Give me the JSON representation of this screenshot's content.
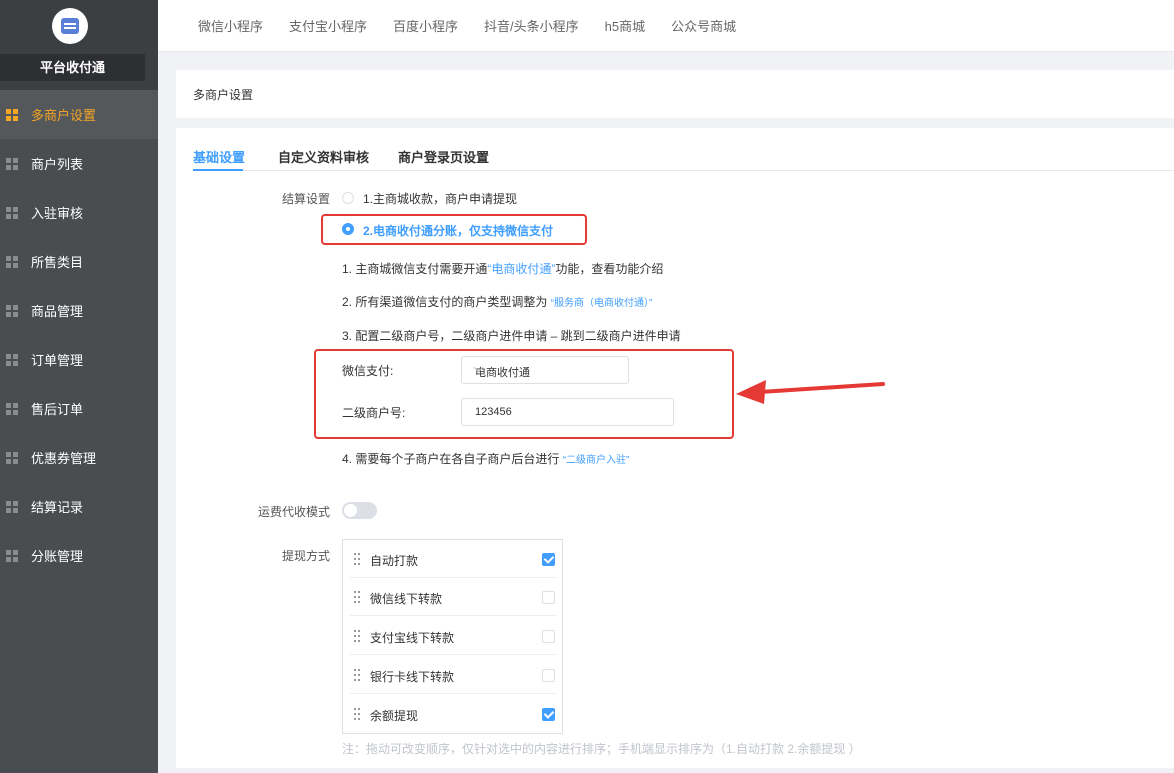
{
  "sidebar": {
    "brand": "平台收付通",
    "items": [
      {
        "label": "多商户设置",
        "active": true
      },
      {
        "label": "商户列表"
      },
      {
        "label": "入驻审核"
      },
      {
        "label": "所售类目"
      },
      {
        "label": "商品管理"
      },
      {
        "label": "订单管理"
      },
      {
        "label": "售后订单"
      },
      {
        "label": "优惠券管理"
      },
      {
        "label": "结算记录"
      },
      {
        "label": "分账管理"
      }
    ]
  },
  "topnav": [
    "微信小程序",
    "支付宝小程序",
    "百度小程序",
    "抖音/头条小程序",
    "h5商城",
    "公众号商城"
  ],
  "page_title": "多商户设置",
  "tabs": [
    "基础设置",
    "自定义资料审核",
    "商户登录页设置"
  ],
  "settlement": {
    "label": "结算设置",
    "option1": "1.主商城收款，商户申请提现",
    "option2": "2.电商收付通分账，仅支持微信支付",
    "step1_a": "1. 主商城微信支付需要开通",
    "step1_link": "“电商收付通”",
    "step1_b": "功能，查看功能介绍",
    "step2_a": "2. 所有渠道微信支付的商户类型调整为",
    "step2_link": "“服务商（电商收付通）”",
    "step3": "3. 配置二级商户号，二级商户进件申请 – 跳到二级商户进件申请",
    "wechat_pay_label": "微信支付:",
    "wechat_pay_value": "电商收付通",
    "sub_merchant_label": "二级商户号:",
    "sub_merchant_value": "123456",
    "step4_a": "4. 需要每个子商户在各自子商户后台进行",
    "step4_link": "“二级商户入驻”"
  },
  "freight": {
    "label": "运费代收模式",
    "enabled": false
  },
  "withdraw": {
    "label": "提现方式",
    "methods": [
      {
        "name": "自动打款",
        "checked": true
      },
      {
        "name": "微信线下转款",
        "checked": false
      },
      {
        "name": "支付宝线下转款",
        "checked": false
      },
      {
        "name": "银行卡线下转款",
        "checked": false
      },
      {
        "name": "余额提现",
        "checked": true
      }
    ],
    "note": "注：拖动可改变顺序，仅针对选中的内容进行排序；手机端显示排序为（1.自动打款 2.余额提现 ）"
  },
  "colors": {
    "accent": "#409eff",
    "highlight": "#e53935",
    "sidebar_active": "#f5a623"
  }
}
